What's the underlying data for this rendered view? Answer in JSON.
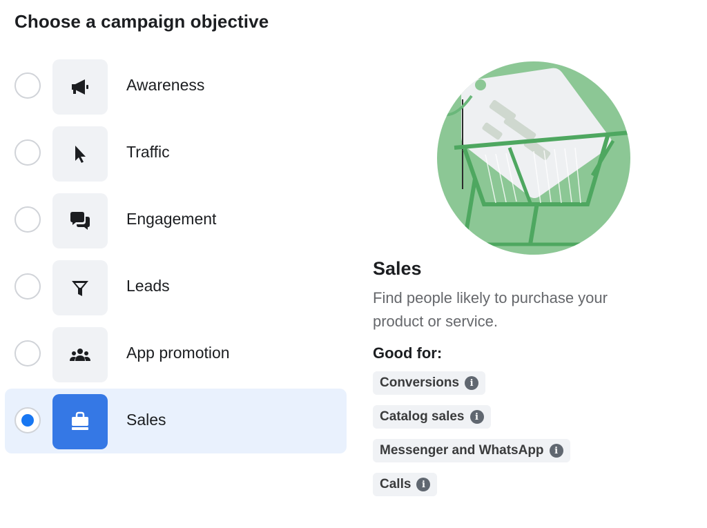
{
  "page": {
    "title": "Choose a campaign objective"
  },
  "objectives": [
    {
      "label": "Awareness",
      "icon": "megaphone-icon",
      "selected": false
    },
    {
      "label": "Traffic",
      "icon": "cursor-icon",
      "selected": false
    },
    {
      "label": "Engagement",
      "icon": "chat-bubbles-icon",
      "selected": false
    },
    {
      "label": "Leads",
      "icon": "funnel-icon",
      "selected": false
    },
    {
      "label": "App promotion",
      "icon": "people-icon",
      "selected": false
    },
    {
      "label": "Sales",
      "icon": "shopping-bag-icon",
      "selected": true
    }
  ],
  "detail": {
    "title": "Sales",
    "description": "Find people likely to purchase your product or service.",
    "good_for_label": "Good for:",
    "tags": [
      {
        "label": "Conversions",
        "info_glyph": "i"
      },
      {
        "label": "Catalog sales",
        "info_glyph": "i"
      },
      {
        "label": "Messenger and WhatsApp",
        "info_glyph": "i"
      },
      {
        "label": "Calls",
        "info_glyph": "i"
      }
    ]
  },
  "colors": {
    "selected_bg": "#e9f1fd",
    "accent": "#1877f2",
    "icon_box_selected": "#3578e5",
    "illustration_green": "#8cc795"
  }
}
